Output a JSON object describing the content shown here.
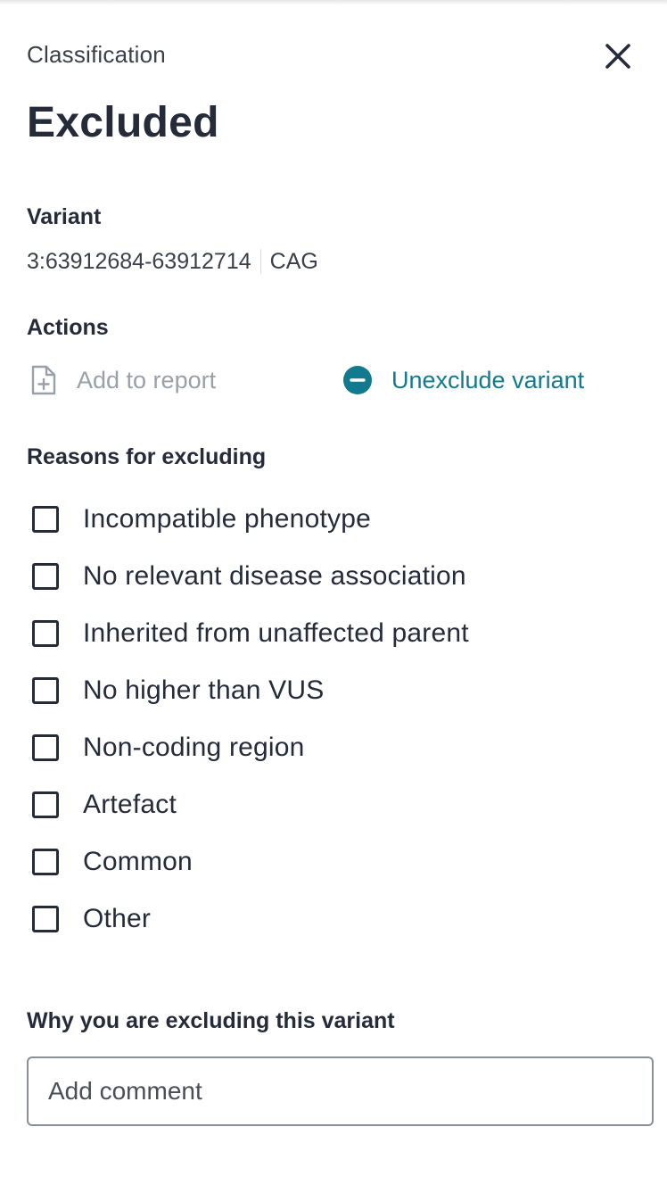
{
  "header": {
    "eyebrow": "Classification",
    "title": "Excluded",
    "close_icon": "close-icon"
  },
  "variant": {
    "label": "Variant",
    "position": "3:63912684-63912714",
    "sequence": "CAG"
  },
  "actions": {
    "label": "Actions",
    "add_to_report": {
      "label": "Add to report",
      "icon": "file-add-icon",
      "enabled": false
    },
    "unexclude": {
      "label": "Unexclude variant",
      "icon": "minus-circle-icon"
    }
  },
  "reasons": {
    "label": "Reasons for excluding",
    "items": [
      {
        "label": "Incompatible phenotype",
        "checked": false
      },
      {
        "label": "No relevant disease association",
        "checked": false
      },
      {
        "label": "Inherited from unaffected parent",
        "checked": false
      },
      {
        "label": "No higher than VUS",
        "checked": false
      },
      {
        "label": "Non-coding region",
        "checked": false
      },
      {
        "label": "Artefact",
        "checked": false
      },
      {
        "label": "Common",
        "checked": false
      },
      {
        "label": "Other",
        "checked": false
      }
    ]
  },
  "comment": {
    "label": "Why you are excluding this variant",
    "placeholder": "Add comment",
    "value": ""
  },
  "colors": {
    "text": "#262b3a",
    "accent": "#117a8e",
    "disabled": "#9aa0a8",
    "border": "#8a8f97"
  }
}
